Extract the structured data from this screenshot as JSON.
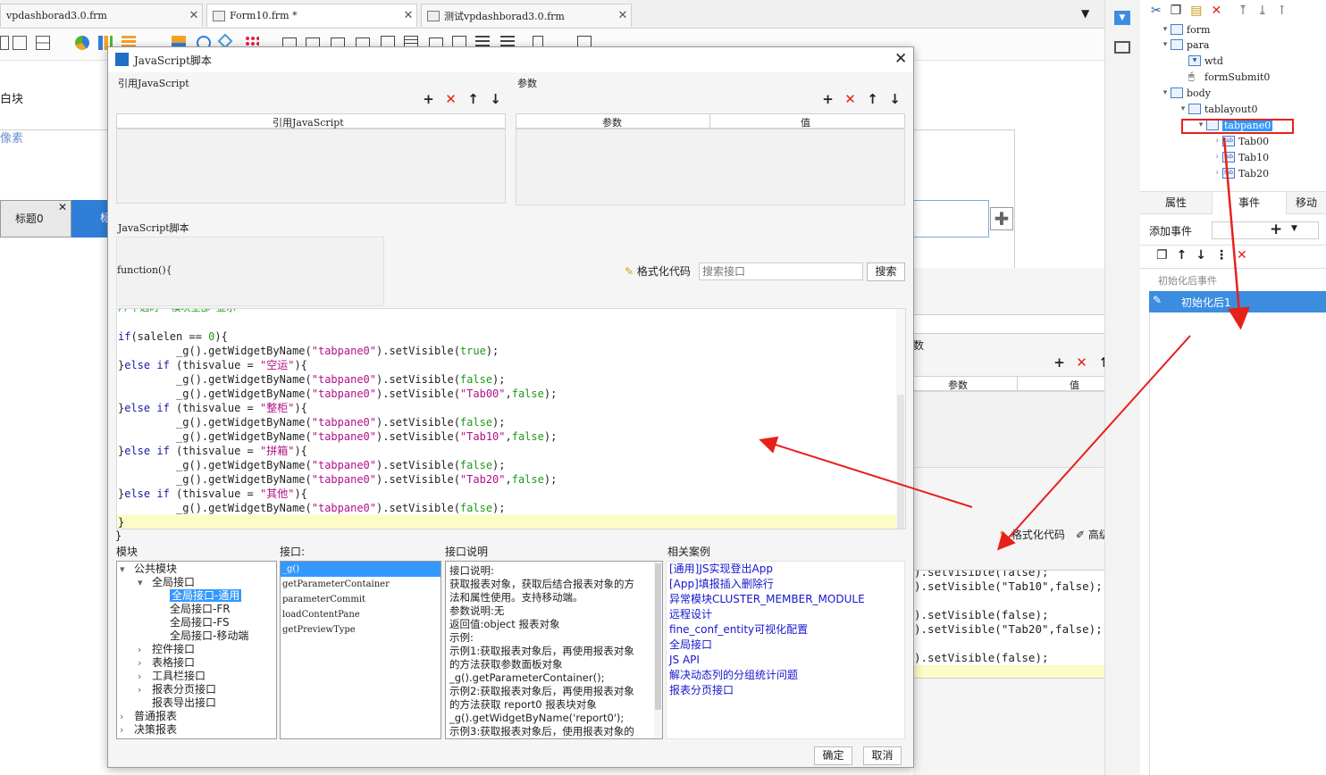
{
  "tabs": [
    {
      "label": "vpdashborad3.0.frm"
    },
    {
      "label": "Form10.frm *"
    },
    {
      "label": "测试vpdashborad3.0.frm"
    }
  ],
  "editor_bg": {
    "white_block": "白块",
    "pixel_label1": "像素",
    "pixel_label2": "像素",
    "tab_title": "标题0",
    "tab_title2": "标"
  },
  "tree": {
    "items": [
      {
        "label": "form",
        "level": 0
      },
      {
        "label": "para",
        "level": 1
      },
      {
        "label": "wtd",
        "level": 2
      },
      {
        "label": "formSubmit0",
        "level": 2
      },
      {
        "label": "body",
        "level": 1
      },
      {
        "label": "tablayout0",
        "level": 2
      },
      {
        "label": "tabpane0",
        "level": 3,
        "selected": true
      },
      {
        "label": "Tab00",
        "level": 4
      },
      {
        "label": "Tab10",
        "level": 4
      },
      {
        "label": "Tab20",
        "level": 4
      }
    ]
  },
  "prop_tabs": [
    "属性",
    "事件",
    "移动"
  ],
  "events": {
    "add_event_label": "添加事件",
    "after_init_header": "初始化后事件",
    "after_init_item": "初始化后1",
    "params_label": "数",
    "param_col": "参数",
    "value_col": "值",
    "format_code": "格式化代码",
    "advanced_edit": "高级编辑",
    "code_lines": [
      ").setVisible(false);",
      ").setVisible(\"Tab10\",false);",
      "",
      ").setVisible(false);",
      ").setVisible(\"Tab20\",false);",
      "",
      ").setVisible(false);"
    ]
  },
  "dialog": {
    "title": "JavaScript脚本",
    "ref_js_label": "引用JavaScript",
    "params_label": "参数",
    "ref_js_col": "引用JavaScript",
    "param_col": "参数",
    "value_col": "值",
    "js_script_label": "JavaScript脚本",
    "function_header": "function(){",
    "format_code": "格式化代码",
    "search_placeholder": "搜索接口",
    "search_button": "搜索",
    "code": {
      "partial_top": "//不选时  模块全部 显示",
      "lines": [
        "",
        "if(salelen == 0){",
        "         _g().getWidgetByName(\"tabpane0\").setVisible(true);",
        "}else if (thisvalue = \"空运\"){",
        "         _g().getWidgetByName(\"tabpane0\").setVisible(false);",
        "         _g().getWidgetByName(\"tabpane0\").setVisible(\"Tab00\",false);",
        "}else if (thisvalue = \"整柜\"){",
        "         _g().getWidgetByName(\"tabpane0\").setVisible(false);",
        "         _g().getWidgetByName(\"tabpane0\").setVisible(\"Tab10\",false);",
        "}else if (thisvalue = \"拼箱\"){",
        "         _g().getWidgetByName(\"tabpane0\").setVisible(false);",
        "         _g().getWidgetByName(\"tabpane0\").setVisible(\"Tab20\",false);",
        "}else if (thisvalue = \"其他\"){",
        "         _g().getWidgetByName(\"tabpane0\").setVisible(false);",
        "}"
      ],
      "closing": "}"
    },
    "module_label": "模块",
    "api_label": "接口:",
    "api_desc_label": "接口说明",
    "cases_label": "相关案例",
    "modules": [
      {
        "label": "公共模块",
        "indent": 0,
        "arrow": "▾"
      },
      {
        "label": "全局接口",
        "indent": 1,
        "arrow": "▾"
      },
      {
        "label": "全局接口-通用",
        "indent": 2,
        "arrow": "",
        "selected": true
      },
      {
        "label": "全局接口-FR",
        "indent": 2,
        "arrow": ""
      },
      {
        "label": "全局接口-FS",
        "indent": 2,
        "arrow": ""
      },
      {
        "label": "全局接口-移动端",
        "indent": 2,
        "arrow": ""
      },
      {
        "label": "控件接口",
        "indent": 1,
        "arrow": "›"
      },
      {
        "label": "表格接口",
        "indent": 1,
        "arrow": "›"
      },
      {
        "label": "工具栏接口",
        "indent": 1,
        "arrow": "›"
      },
      {
        "label": "报表分页接口",
        "indent": 1,
        "arrow": "›"
      },
      {
        "label": "报表导出接口",
        "indent": 1,
        "arrow": ""
      },
      {
        "label": "普通报表",
        "indent": 0,
        "arrow": "›"
      },
      {
        "label": "决策报表",
        "indent": 0,
        "arrow": "›"
      }
    ],
    "apis": [
      "_g()",
      "getParameterContainer",
      "parameterCommit",
      "loadContentPane",
      "getPreviewType"
    ],
    "api_desc": [
      "接口说明:",
      "获取报表对象，获取后结合报表对象的方",
      "法和属性使用。支持移动端。",
      "参数说明:无",
      "返回值:object 报表对象",
      "示例:",
      "示例1:获取报表对象后，再使用报表对象",
      "的方法获取参数面板对象",
      "_g().getParameterContainer();",
      "示例2:获取报表对象后，再使用报表对象",
      "的方法获取 report0 报表块对象",
      "_g().getWidgetByName('report0');",
      "示例3:获取报表对象后，使用报表对象的"
    ],
    "cases": [
      "[通用]JS实现登出App",
      "[App]填报插入删除行",
      "异常模块CLUSTER_MEMBER_MODULE",
      "远程设计",
      "fine_conf_entity可视化配置",
      "全局接口",
      "JS API",
      "解决动态列的分组统计问题",
      "报表分页接口"
    ],
    "ok_button": "确定",
    "cancel_button": "取消"
  },
  "colors": {
    "accent": "#3c8de0",
    "selection": "#3399ff",
    "arrow_red": "#e8201a",
    "highlight_line": "#fdfcc8"
  }
}
